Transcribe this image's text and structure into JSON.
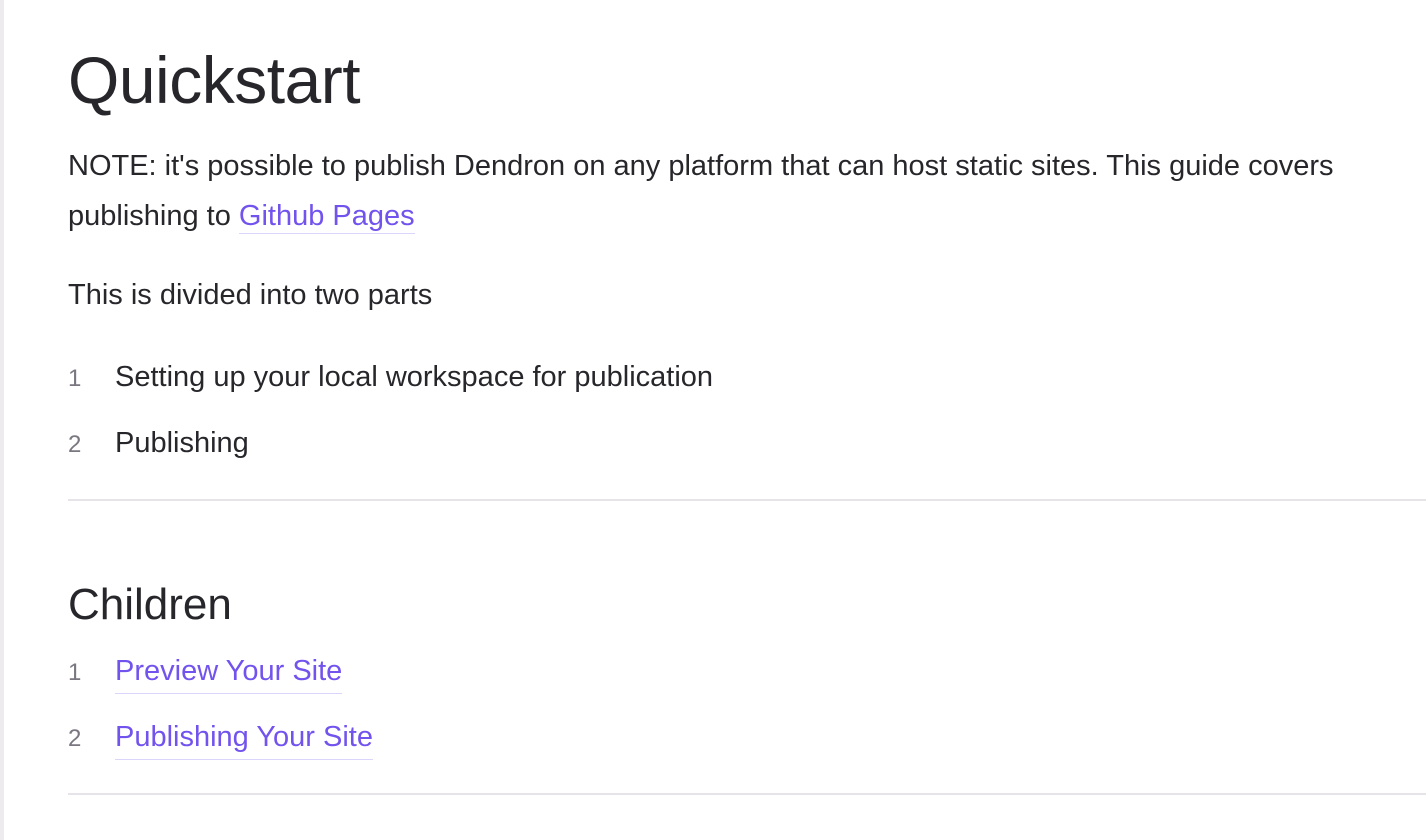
{
  "page": {
    "title": "Quickstart",
    "note_line1": "NOTE: it's possible to publish Dendron on any platform that can host static sites. This guide covers",
    "note_line2_prefix": "publishing to ",
    "note_link": "Github Pages",
    "intro": "This is divided into two parts",
    "steps": [
      {
        "num": "1",
        "label": "Setting up your local workspace for publication"
      },
      {
        "num": "2",
        "label": "Publishing"
      }
    ],
    "children_heading": "Children",
    "children": [
      {
        "num": "1",
        "label": "Preview Your Site"
      },
      {
        "num": "2",
        "label": "Publishing Your Site"
      }
    ]
  },
  "colors": {
    "text": "#27262b",
    "link": "#7253ed",
    "muted": "#7a7780",
    "divider": "#e6e4e8"
  }
}
